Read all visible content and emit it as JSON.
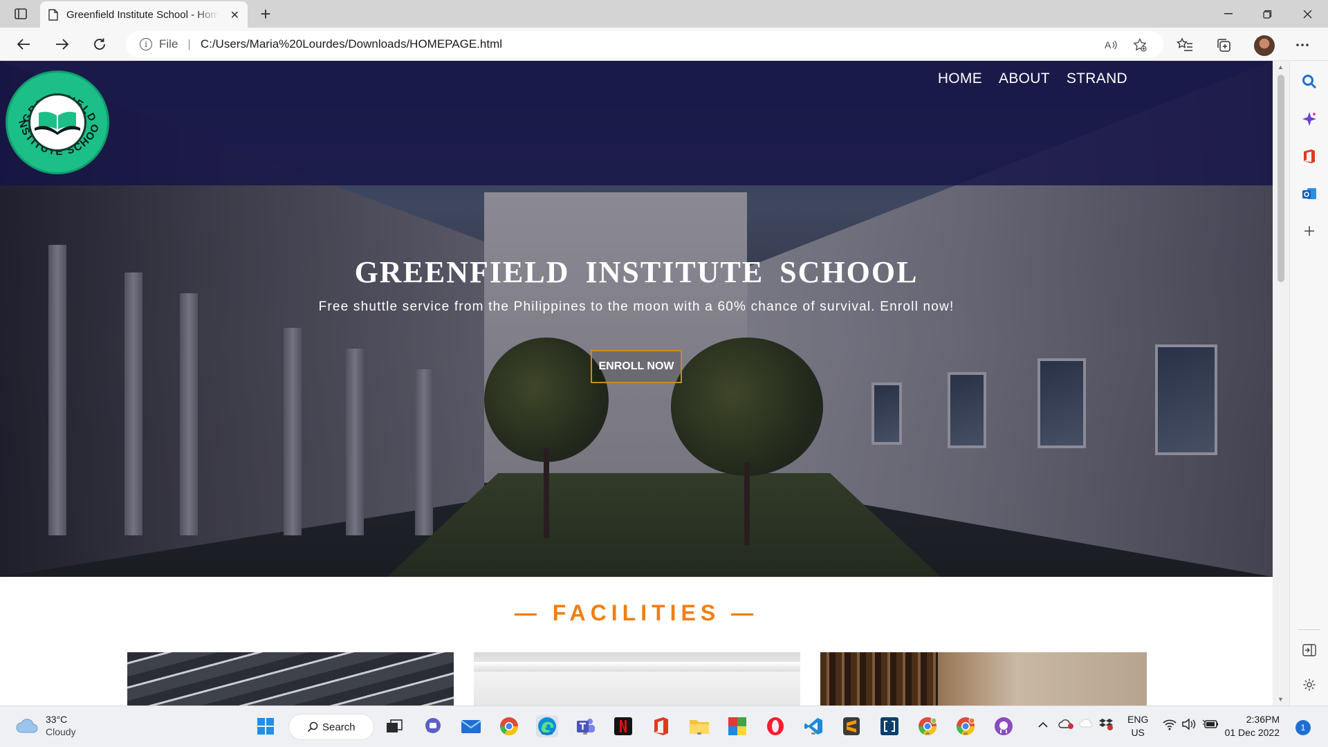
{
  "browser": {
    "tab_title": "Greenfield Institute School - Homepage",
    "tab_title_visible": "Greenfield Institute School - Hon",
    "address_scheme": "File",
    "address_url": "C:/Users/Maria%20Lourdes/Downloads/HOMEPAGE.html"
  },
  "site": {
    "logo_text_top": "GREENFIELD",
    "logo_text_bottom": "INSTITUTE SCHOOL",
    "nav": [
      "HOME",
      "ABOUT",
      "STRAND"
    ],
    "hero_title": "GREENFIELD  INSTITUTE  SCHOOL",
    "hero_subtitle": "Free shuttle service from the Philippines to the moon with a 60% chance of survival. Enroll now!",
    "cta_label": "ENROLL NOW",
    "section_title": "— FACILITIES —"
  },
  "taskbar": {
    "weather_temp": "33°C",
    "weather_desc": "Cloudy",
    "search_label": "Search",
    "lang_top": "ENG",
    "lang_bottom": "US",
    "time": "2:36PM",
    "date": "01 Dec 2022",
    "notifications": "1"
  },
  "colors": {
    "accent_orange": "#f07f0f",
    "header_band": "#161448",
    "logo_green": "#1cbf88",
    "edge_blue": "#1f6fd0"
  }
}
